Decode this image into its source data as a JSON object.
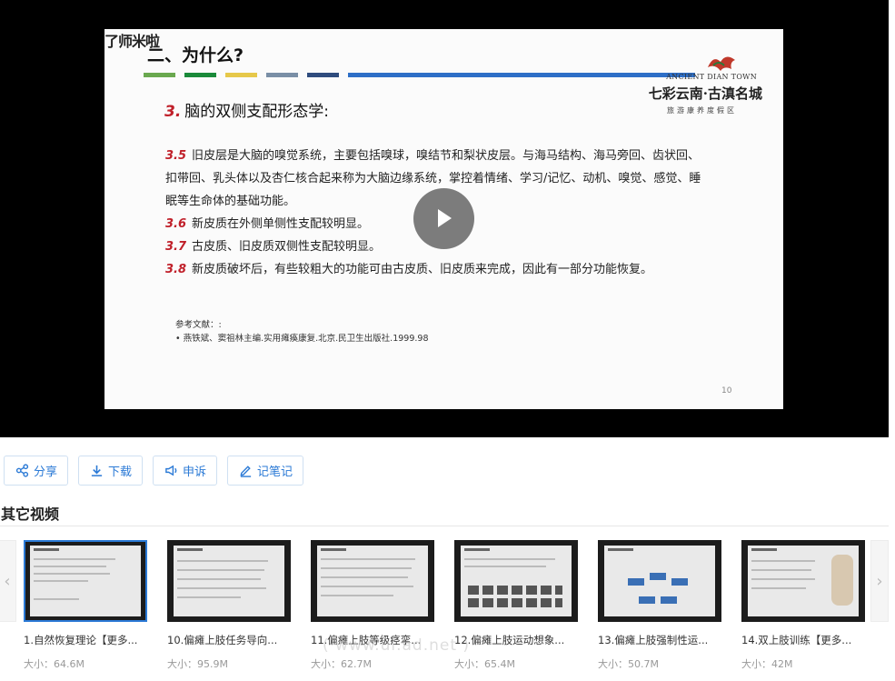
{
  "slide": {
    "watermark": "了师米啦",
    "heading": "二、为什么?",
    "bar_colors": [
      "#6aa84f",
      "#1a8a3a",
      "#e6c84a",
      "#7a8fa6",
      "#2f4c7e",
      "#2e6fc7"
    ],
    "logo_en": "ANCIENT DIAN TOWN",
    "logo_cn": "七彩云南·古滇名城",
    "logo_sub": "旅游康养度假区",
    "section_num": "3.",
    "section_title": "脑的双侧支配形态学:",
    "items": [
      {
        "num": "3.5",
        "text": "旧皮层是大脑的嗅觉系统，主要包括嗅球，嗅结节和梨状皮层。与海马结构、海马旁回、齿状回、扣带回、乳头体以及杏仁核合起来称为大脑边缘系统，掌控着情绪、学习/记忆、动机、嗅觉、感觉、睡眠等生命体的基础功能。"
      },
      {
        "num": "3.6",
        "text": "新皮质在外侧单侧性支配较明显。"
      },
      {
        "num": "3.7",
        "text": "古皮质、旧皮质双侧性支配较明显。"
      },
      {
        "num": "3.8",
        "text": "新皮质破坏后，有些较粗大的功能可由古皮质、旧皮质来完成，因此有一部分功能恢复。"
      }
    ],
    "ref_title": "参考文献：:",
    "ref_item": "•   燕铁斌、窦祖林主编.实用瘫痪康复.北京.民卫生出版社.1999.98",
    "page_num": "10"
  },
  "actions": [
    {
      "label": "分享",
      "icon": "share-icon"
    },
    {
      "label": "下载",
      "icon": "download-icon"
    },
    {
      "label": "申诉",
      "icon": "megaphone-icon"
    },
    {
      "label": "记笔记",
      "icon": "pen-icon"
    }
  ],
  "other_videos_title": "其它视频",
  "cards": [
    {
      "title": "1.自然恢复理论【更多...",
      "size": "大小：64.6M",
      "active": true
    },
    {
      "title": "10.偏瘫上肢任务导向...",
      "size": "大小：95.9M"
    },
    {
      "title": "11.偏瘫上肢等级痉挛...",
      "size": "大小：62.7M"
    },
    {
      "title": "12.偏瘫上肢运动想象...",
      "size": "大小：65.4M"
    },
    {
      "title": "13.偏瘫上肢强制性运...",
      "size": "大小：50.7M"
    },
    {
      "title": "14.双上肢训练【更多...",
      "size": "大小：42M"
    }
  ],
  "overlay_watermark": "( www.ui.ad.net )",
  "nav": {
    "prev": "‹",
    "next": "›"
  }
}
